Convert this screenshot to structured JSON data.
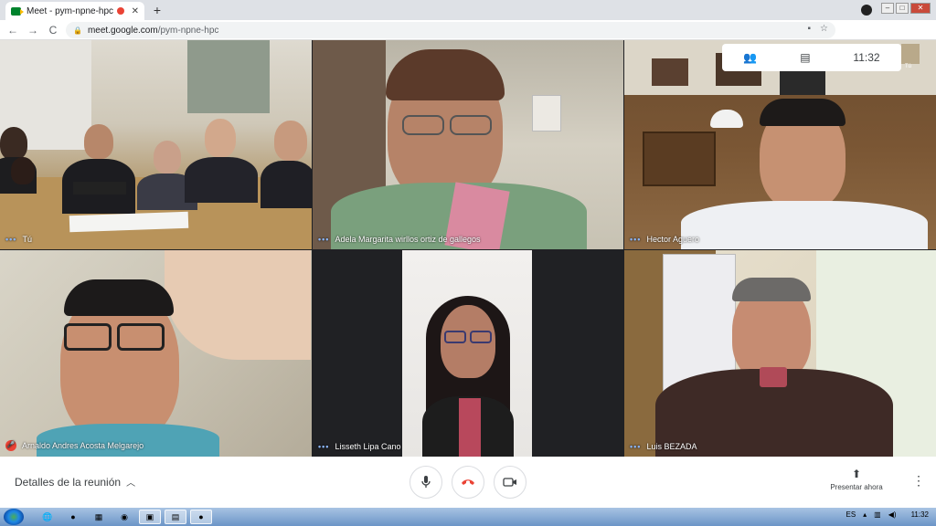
{
  "browser": {
    "tab_title": "Meet - pym-npne-hpc",
    "tab_close": "✕",
    "new_tab": "+",
    "url_host": "meet.google.com",
    "url_path": "/pym-npne-hpc",
    "nav_back": "←",
    "nav_forward": "→",
    "nav_reload": "C"
  },
  "meet": {
    "clock": "11:32",
    "self_mini_label": "Tú",
    "tiles": [
      {
        "name": "Tú",
        "mic_muted": false
      },
      {
        "name": "Adela Margarita wirllos ortiz de gallegos",
        "mic_muted": false
      },
      {
        "name": "Hector Aguero",
        "mic_muted": false
      },
      {
        "name": "Arnaldo Andres Acosta Melgarejo",
        "mic_muted": true
      },
      {
        "name": "Lisseth Lipa Cano",
        "mic_muted": false
      },
      {
        "name": "Luis BEZADA",
        "mic_muted": false
      }
    ],
    "details_label": "Detalles de la reunión",
    "present_label": "Presentar ahora"
  },
  "taskbar": {
    "lang": "ES",
    "clock": "11:32"
  },
  "colors": {
    "accent_blue": "#8ab4f8",
    "hangup_red": "#ea4335",
    "meet_bg": "#202124"
  }
}
